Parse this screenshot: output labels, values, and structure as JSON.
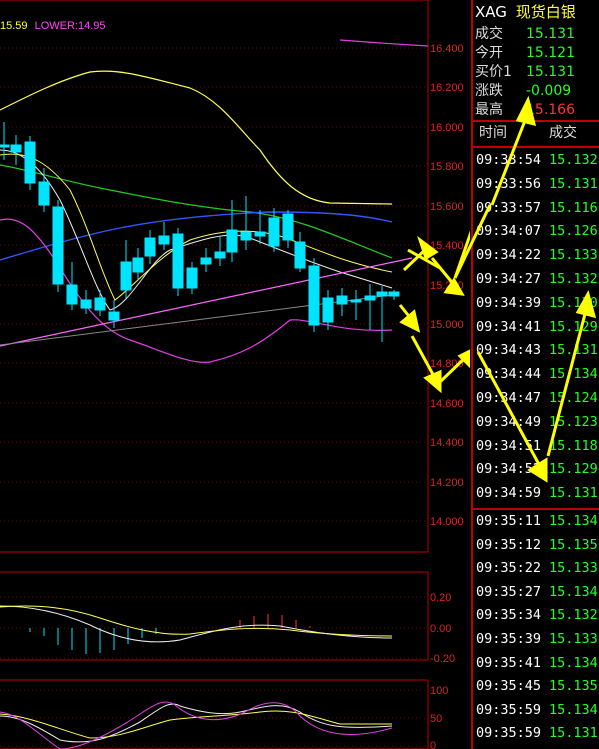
{
  "indicator": {
    "prefix": "15.59",
    "lower_label": "LOWER:14.95"
  },
  "colors": {
    "up": "#ff3333",
    "down": "#00e5ff",
    "green": "#22ff22",
    "yellow": "#ffff33",
    "axis": "#d22"
  },
  "price_axis_labels": [
    "16.400",
    "16.200",
    "16.000",
    "15.800",
    "15.600",
    "15.400",
    "15.200",
    "15.000",
    "14.800",
    "14.600",
    "14.400",
    "14.200",
    "14.000"
  ],
  "macd_axis_labels": [
    "0.20",
    "0.00",
    "-0.20"
  ],
  "kdj_axis_labels": [
    "100",
    "50",
    "0"
  ],
  "symbol": {
    "code": "XAG",
    "name": "现货白银"
  },
  "quote": [
    {
      "label": "成交",
      "value": "15.131",
      "color": "#22ff22"
    },
    {
      "label": "今开",
      "value": "15.121",
      "color": "#22ff22"
    },
    {
      "label": "买价1",
      "value": "15.131",
      "color": "#22ff22"
    },
    {
      "label": "涨跌",
      "value": "-0.009",
      "color": "#22ff22"
    },
    {
      "label": "最高",
      "value": "15.166",
      "color": "#ff3333"
    }
  ],
  "ticks_header": {
    "time": "时间",
    "price": "成交"
  },
  "ticks": [
    {
      "time": "09:33:54",
      "price": "15.132"
    },
    {
      "time": "09:33:56",
      "price": "15.131"
    },
    {
      "time": "09:33:57",
      "price": "15.116"
    },
    {
      "time": "09:34:07",
      "price": "15.126"
    },
    {
      "time": "09:34:22",
      "price": "15.133"
    },
    {
      "time": "09:34:27",
      "price": "15.132"
    },
    {
      "time": "09:34:39",
      "price": "15.130"
    },
    {
      "time": "09:34:41",
      "price": "15.129"
    },
    {
      "time": "09:34:43",
      "price": "15.131"
    },
    {
      "time": "09:34:44",
      "price": "15.134"
    },
    {
      "time": "09:34:47",
      "price": "15.124"
    },
    {
      "time": "09:34:49",
      "price": "15.123"
    },
    {
      "time": "09:34:51",
      "price": "15.118"
    },
    {
      "time": "09:34:52",
      "price": "15.129"
    },
    {
      "time": "09:34:59",
      "price": "15.131"
    },
    {
      "time": "09:35:11",
      "price": "15.134"
    },
    {
      "time": "09:35:12",
      "price": "15.135"
    },
    {
      "time": "09:35:22",
      "price": "15.133"
    },
    {
      "time": "09:35:27",
      "price": "15.134"
    },
    {
      "time": "09:35:34",
      "price": "15.132"
    },
    {
      "time": "09:35:39",
      "price": "15.133"
    },
    {
      "time": "09:35:41",
      "price": "15.134"
    },
    {
      "time": "09:35:45",
      "price": "15.135"
    },
    {
      "time": "09:35:59",
      "price": "15.134"
    },
    {
      "time": "09:35:59",
      "price": "15.131"
    }
  ]
}
